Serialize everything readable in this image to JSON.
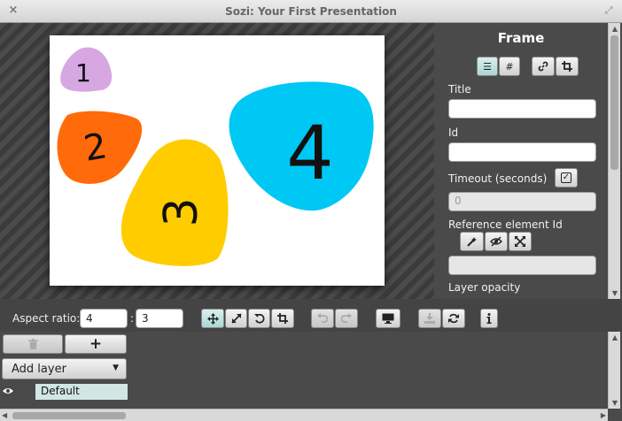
{
  "window": {
    "title": "Sozi: Your First Presentation",
    "close_glyph": "×",
    "maximize_glyph": "⤢"
  },
  "slide": {
    "shapes": [
      {
        "label": "1",
        "color": "#d7a7e2"
      },
      {
        "label": "2",
        "color": "#ff6b0a"
      },
      {
        "label": "3",
        "color": "#ffcc00"
      },
      {
        "label": "4",
        "color": "#00c8f4"
      }
    ]
  },
  "properties": {
    "heading": "Frame",
    "title_label": "Title",
    "title_value": "",
    "id_label": "Id",
    "id_value": "",
    "timeout_label": "Timeout (seconds)",
    "timeout_placeholder": "0",
    "reference_label": "Reference element Id",
    "reference_value": "",
    "opacity_label": "Layer opacity"
  },
  "toolbar": {
    "aspect_ratio_label": "Aspect ratio:",
    "ratio_width": "4",
    "ratio_separator": ":",
    "ratio_height": "3"
  },
  "layers": {
    "add_layer_label": "Add layer",
    "add_glyph": "+",
    "items": [
      {
        "name": "Default",
        "visible": true
      }
    ]
  },
  "colors": {
    "accent_active": "#b5dcd8",
    "panel_bg": "#4a4a4a"
  }
}
